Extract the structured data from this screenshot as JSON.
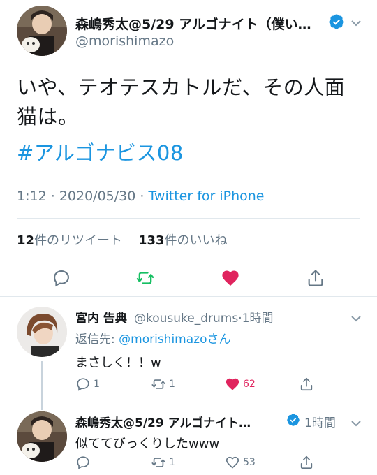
{
  "main_tweet": {
    "author_name": "森嶋秀太@5/29 アルゴナイト（僕い…",
    "handle": "@morishimazo",
    "verified": true,
    "text": "いや、テオテスカトルだ、その人面猫は。",
    "hashtag": "#アルゴナビス08",
    "time": "1:12",
    "date": "2020/05/30",
    "meta_sep": "·",
    "source": "Twitter for iPhone",
    "retweets_count": "12",
    "retweets_label": "件のリツイート",
    "likes_count": "133",
    "likes_label": "件のいいね",
    "liked": true
  },
  "replies": [
    {
      "author_name": "宮内 告典",
      "handle": "@kousuke_drums",
      "time": "·1時間",
      "reply_to_label": "返信先: ",
      "reply_to_handle": "@morishimazo",
      "reply_to_suffix": "さん",
      "text": "まさしく！！w",
      "reply_count": "1",
      "retweet_count": "1",
      "like_count": "62",
      "liked": true
    },
    {
      "author_name": "森嶋秀太@5/29 アルゴナイト…",
      "verified": true,
      "time": "1時間",
      "text": "似ててびっくりしたwww",
      "reply_count": "",
      "retweet_count": "1",
      "like_count": "53",
      "liked": false
    }
  ],
  "colors": {
    "brand_blue": "#1b95e0",
    "like_red": "#e0245e",
    "retweet_green": "#17bf63",
    "muted": "#657786",
    "text": "#14171a",
    "divider": "#e1e8ed"
  }
}
